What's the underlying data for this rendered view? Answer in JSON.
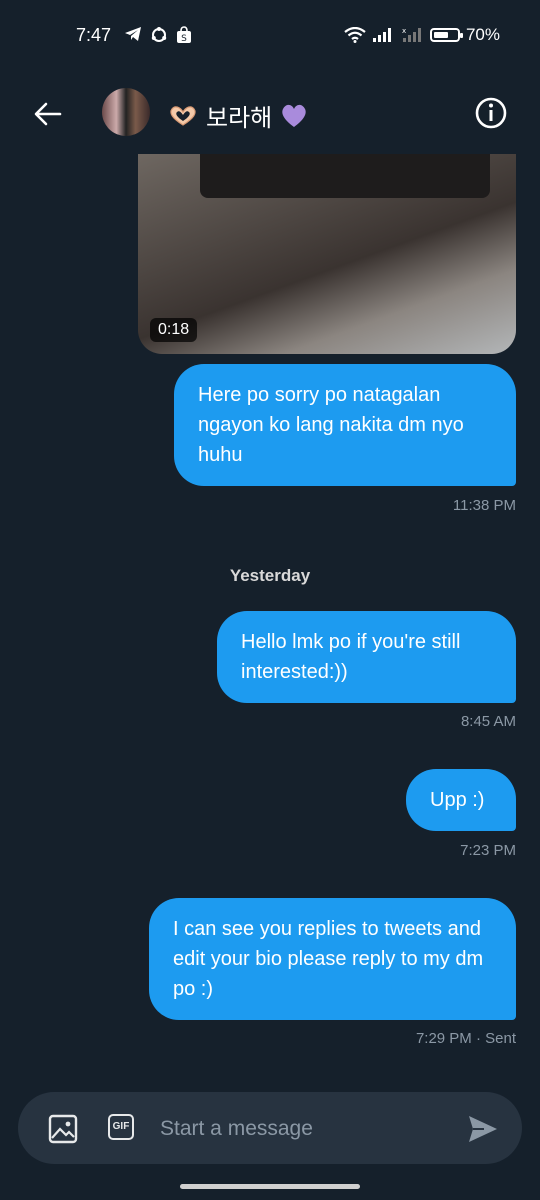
{
  "status_bar": {
    "time": "7:47",
    "battery_percent": "70%",
    "battery_level": 0.7
  },
  "header": {
    "title": "보라해",
    "back_icon": "arrow-left-icon",
    "info_icon": "info-circle-icon",
    "title_prefix_emoji": "🫶",
    "title_suffix_emoji": "💜"
  },
  "media": {
    "duration": "0:18"
  },
  "messages": [
    {
      "text": "Here po sorry po natagalan ngayon ko lang nakita dm nyo huhu",
      "meta": "11:38 PM"
    },
    {
      "text": "Hello lmk po if you're still interested:))",
      "meta": "8:45 AM"
    },
    {
      "text": "Upp :)",
      "meta": "7:23 PM"
    },
    {
      "text": "I can see you replies to tweets and edit your bio please reply to my dm po :)",
      "meta": "7:29 PM · Sent"
    }
  ],
  "day_separator": "Yesterday",
  "composer": {
    "placeholder": "Start a message",
    "gif_label": "GIF"
  },
  "colors": {
    "background": "#15202b",
    "bubble": "#1d9bf0",
    "composer": "#273340",
    "meta_text": "#8b98a5"
  }
}
